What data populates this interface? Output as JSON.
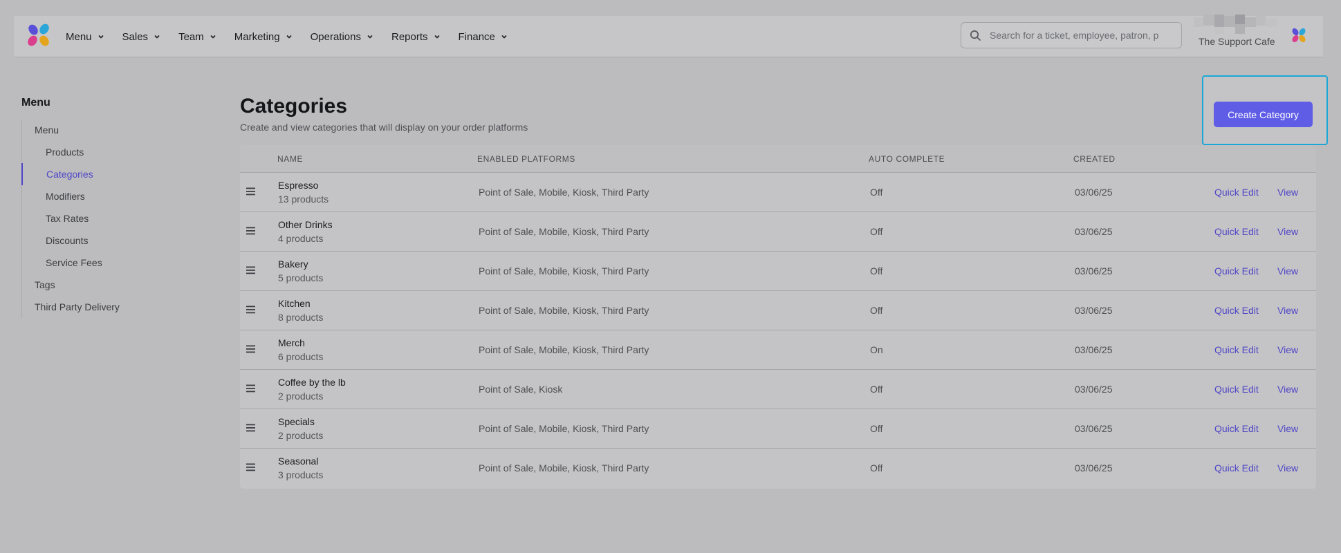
{
  "colors": {
    "accent": "#5f5ce6",
    "link": "#4f46c7",
    "focus_ring": "#1ba7d6"
  },
  "topnav": {
    "items": [
      {
        "label": "Menu",
        "icon": "chevron-down-icon"
      },
      {
        "label": "Sales",
        "icon": "chevron-down-icon"
      },
      {
        "label": "Team",
        "icon": "chevron-down-icon"
      },
      {
        "label": "Marketing",
        "icon": "chevron-down-icon"
      },
      {
        "label": "Operations",
        "icon": "chevron-down-icon"
      },
      {
        "label": "Reports",
        "icon": "chevron-down-icon"
      },
      {
        "label": "Finance",
        "icon": "chevron-down-icon"
      }
    ],
    "search_placeholder": "Search for a ticket, employee, patron, p",
    "org_name": "The Support Cafe"
  },
  "sidebar": {
    "title": "Menu",
    "items": [
      {
        "label": "Menu"
      },
      {
        "label": "Products"
      },
      {
        "label": "Categories"
      },
      {
        "label": "Modifiers"
      },
      {
        "label": "Tax Rates"
      },
      {
        "label": "Discounts"
      },
      {
        "label": "Service Fees"
      },
      {
        "label": "Tags"
      },
      {
        "label": "Third Party Delivery"
      }
    ]
  },
  "page": {
    "title": "Categories",
    "subtitle": "Create and view categories that will display on your order platforms",
    "create_label": "Create Category"
  },
  "table": {
    "headers": {
      "name": "NAME",
      "platforms": "ENABLED PLATFORMS",
      "auto": "AUTO COMPLETE",
      "created": "CREATED"
    },
    "actions": {
      "quick_edit": "Quick Edit",
      "view": "View"
    },
    "rows": [
      {
        "name": "Espresso",
        "count": "13 products",
        "platforms": "Point of Sale, Mobile, Kiosk, Third Party",
        "auto": "Off",
        "created": "03/06/25"
      },
      {
        "name": "Other Drinks",
        "count": "4 products",
        "platforms": "Point of Sale, Mobile, Kiosk, Third Party",
        "auto": "Off",
        "created": "03/06/25"
      },
      {
        "name": "Bakery",
        "count": "5 products",
        "platforms": "Point of Sale, Mobile, Kiosk, Third Party",
        "auto": "Off",
        "created": "03/06/25"
      },
      {
        "name": "Kitchen",
        "count": "8 products",
        "platforms": "Point of Sale, Mobile, Kiosk, Third Party",
        "auto": "Off",
        "created": "03/06/25"
      },
      {
        "name": "Merch",
        "count": "6 products",
        "platforms": "Point of Sale, Mobile, Kiosk, Third Party",
        "auto": "On",
        "created": "03/06/25"
      },
      {
        "name": "Coffee by the lb",
        "count": "2 products",
        "platforms": "Point of Sale, Kiosk",
        "auto": "Off",
        "created": "03/06/25"
      },
      {
        "name": "Specials",
        "count": "2 products",
        "platforms": "Point of Sale, Mobile, Kiosk, Third Party",
        "auto": "Off",
        "created": "03/06/25"
      },
      {
        "name": "Seasonal",
        "count": "3 products",
        "platforms": "Point of Sale, Mobile, Kiosk, Third Party",
        "auto": "Off",
        "created": "03/06/25"
      }
    ]
  }
}
